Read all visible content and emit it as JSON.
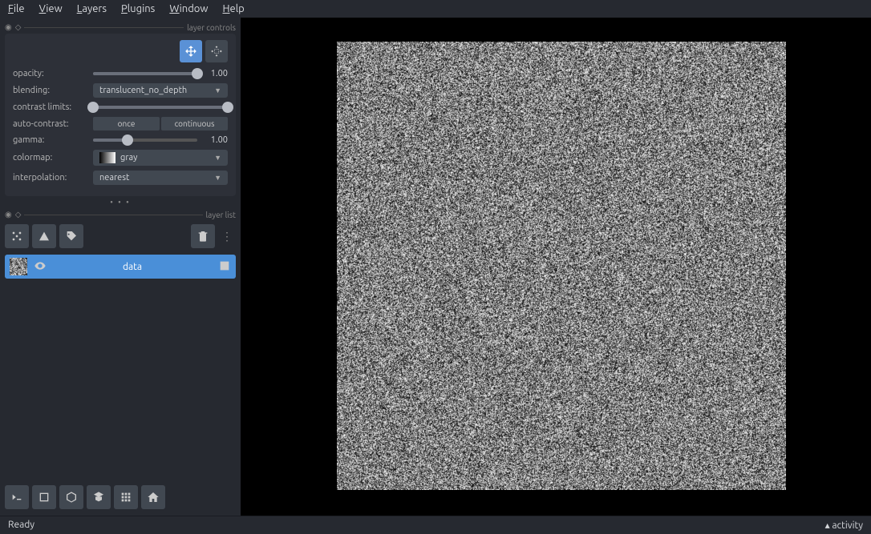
{
  "menu": {
    "file": "File",
    "view": "View",
    "layers": "Layers",
    "plugins": "Plugins",
    "window": "Window",
    "help": "Help"
  },
  "panels": {
    "controls_title": "layer controls",
    "list_title": "layer list"
  },
  "controls": {
    "opacity_label": "opacity:",
    "opacity_value": "1.00",
    "blending_label": "blending:",
    "blending_value": "translucent_no_depth",
    "contrast_label": "contrast limits:",
    "autocontrast_label": "auto-contrast:",
    "autocontrast_once": "once",
    "autocontrast_continuous": "continuous",
    "gamma_label": "gamma:",
    "gamma_value": "1.00",
    "colormap_label": "colormap:",
    "colormap_value": "gray",
    "interpolation_label": "interpolation:",
    "interpolation_value": "nearest"
  },
  "layers": [
    {
      "name": "data"
    }
  ],
  "status": {
    "left": "Ready",
    "right": "activity"
  }
}
